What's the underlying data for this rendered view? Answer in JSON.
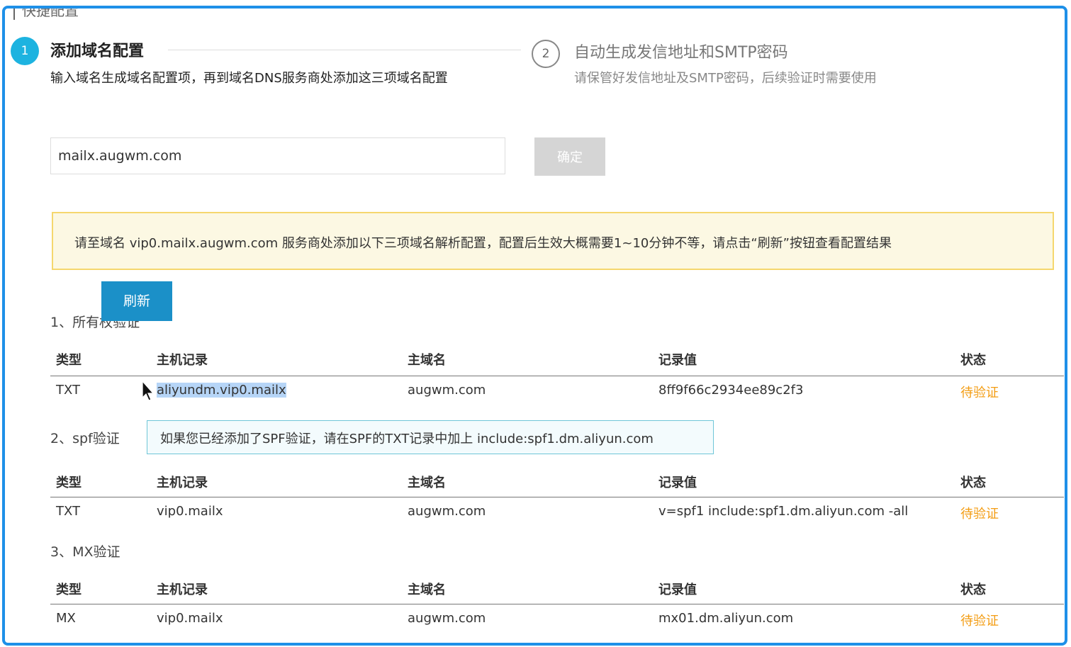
{
  "header": {
    "title": "快捷配置"
  },
  "steps": [
    {
      "number": "1",
      "title": "添加域名配置",
      "description": "输入域名生成域名配置项，再到域名DNS服务商处添加这三项域名配置"
    },
    {
      "number": "2",
      "title": "自动生成发信地址和SMTP密码",
      "description": "请保管好发信地址及SMTP密码，后续验证时需要使用"
    }
  ],
  "domain_form": {
    "value": "mailx.augwm.com",
    "confirm_label": "确定"
  },
  "notice": {
    "text": "请至域名 vip0.mailx.augwm.com 服务商处添加以下三项域名解析配置，配置后生效大概需要1~10分钟不等，请点击“刷新”按钮查看配置结果"
  },
  "refresh_label": "刷新",
  "columns": [
    "类型",
    "主机记录",
    "主域名",
    "记录值",
    "状态"
  ],
  "sections": [
    {
      "label": "1、所有权验证",
      "row": {
        "type": "TXT",
        "host": "aliyundm.vip0.mailx",
        "domain": "augwm.com",
        "value": "8ff9f66c2934ee89c2f3",
        "status": "待验证"
      }
    },
    {
      "label": "2、spf验证",
      "tip": "如果您已经添加了SPF验证，请在SPF的TXT记录中加上 include:spf1.dm.aliyun.com",
      "row": {
        "type": "TXT",
        "host": "vip0.mailx",
        "domain": "augwm.com",
        "value": "v=spf1 include:spf1.dm.aliyun.com -all",
        "status": "待验证"
      }
    },
    {
      "label": "3、MX验证",
      "row": {
        "type": "MX",
        "host": "vip0.mailx",
        "domain": "augwm.com",
        "value": "mx01.dm.aliyun.com",
        "status": "待验证"
      }
    }
  ],
  "colors": {
    "frame": "#1e90e8",
    "step_active": "#1db3e0",
    "refresh": "#1b90c8",
    "pending": "#f39c12",
    "notice_bg": "#fcf8e3"
  }
}
